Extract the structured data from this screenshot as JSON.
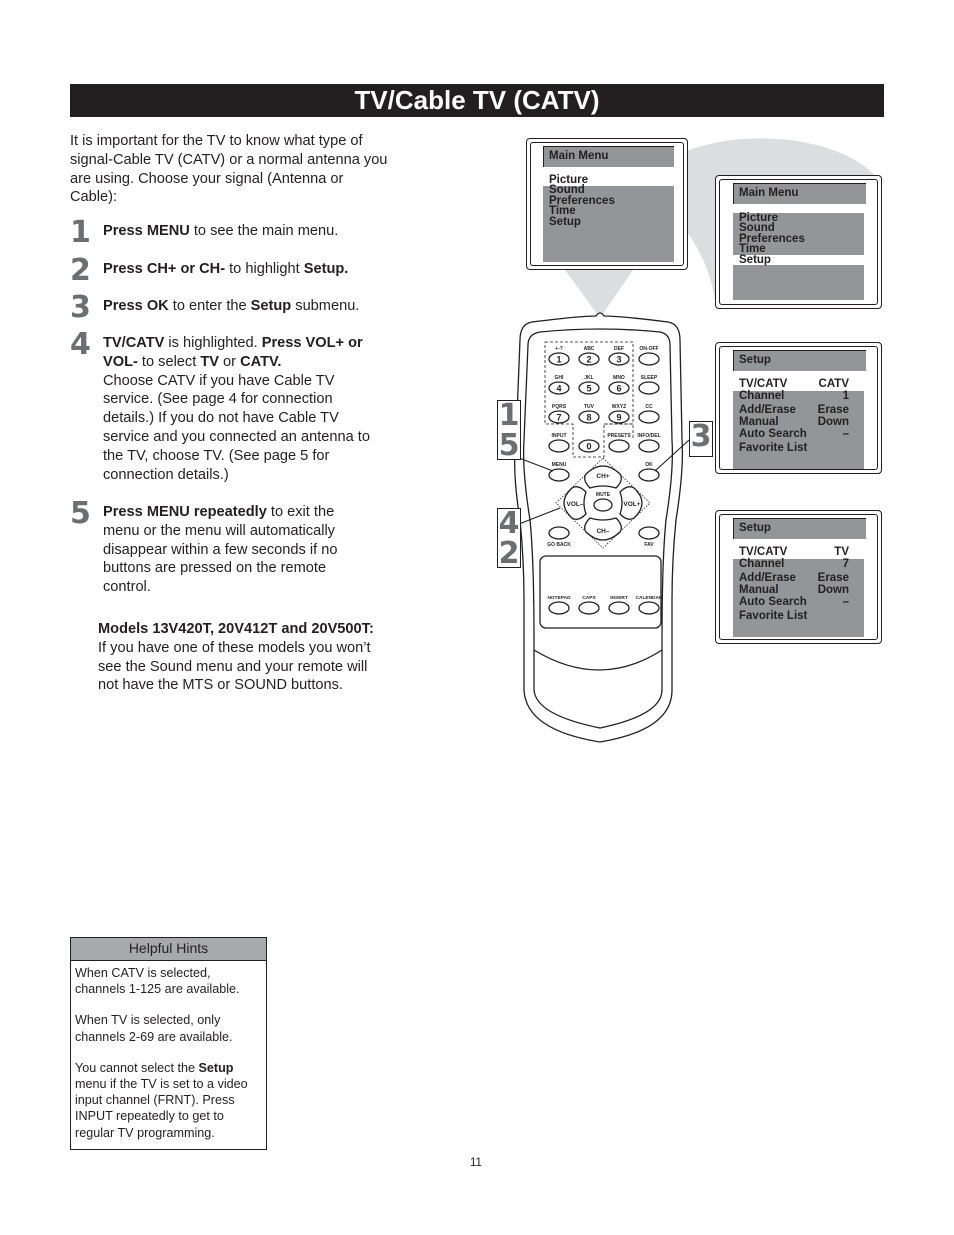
{
  "page": {
    "title": "TV/Cable TV (CATV)",
    "intro": "It is important for the TV to know what type of signal-Cable TV (CATV) or a normal antenna you are using. Choose your signal (Antenna or Cable):",
    "page_number": "11"
  },
  "steps": [
    {
      "num": "1",
      "parts": [
        {
          "b": "Press MENU"
        },
        {
          "t": " to see the main menu."
        }
      ]
    },
    {
      "num": "2",
      "parts": [
        {
          "b": "Press CH+ or CH-"
        },
        {
          "t": " to highlight "
        },
        {
          "b": "Setup."
        }
      ]
    },
    {
      "num": "3",
      "parts": [
        {
          "b": "Press OK"
        },
        {
          "t": " to enter the "
        },
        {
          "b": "Setup"
        },
        {
          "t": " submenu."
        }
      ]
    },
    {
      "num": "4",
      "parts": [
        {
          "b": "TV/CATV"
        },
        {
          "t": " is highlighted. "
        },
        {
          "b": "Press VOL+ or VOL-"
        },
        {
          "t": " to select "
        },
        {
          "b": "TV"
        },
        {
          "t": " or "
        },
        {
          "b": "CATV."
        },
        {
          "br": true
        },
        {
          "t": "Choose CATV if you have Cable TV service. (See page 4 for connection details.) If you do not have Cable TV service and you connected an antenna to the TV, choose TV. (See page 5 for connection details.)"
        }
      ]
    },
    {
      "num": "5",
      "parts": [
        {
          "b": "Press MENU repeatedly"
        },
        {
          "t": " to exit the menu or the menu will automatically disappear within a few seconds if no buttons are pressed on the remote control."
        }
      ]
    }
  ],
  "models_note": {
    "heading": "Models 13V420T, 20V412T and 20V500T:",
    "text": "If you have one of these models you won’t see the Sound menu and your remote will not have the MTS or SOUND buttons."
  },
  "helpful_hints": {
    "title": "Helpful Hints",
    "hint1": "When CATV is selected, channels 1-125 are available.",
    "hint2": "When TV is selected, only channels 2-69 are available.",
    "hint3_pre": "You cannot select the ",
    "hint3_bold": "Setup",
    "hint3_post": " menu if the TV is set to a video input channel (FRNT). Press INPUT repeatedly to get to regular TV programming."
  },
  "screens": {
    "main_menu_1": {
      "header": "Main Menu",
      "items": [
        "Picture",
        "Sound",
        "Preferences",
        "Time",
        "Setup"
      ],
      "highlighted": "Picture"
    },
    "main_menu_2": {
      "header": "Main Menu",
      "items": [
        "Picture",
        "Sound",
        "Preferences",
        "Time",
        "Setup"
      ],
      "highlighted": "Setup"
    },
    "setup_catv": {
      "header": "Setup",
      "rows": [
        {
          "label": "TV/CATV",
          "value": "CATV"
        },
        {
          "label": "Channel",
          "value": "1"
        },
        {
          "label": "Add/Erase",
          "value": "Erase"
        },
        {
          "label": "Manual",
          "value": "Down"
        },
        {
          "label": "Auto Search",
          "value": "–"
        },
        {
          "label": "Favorite List",
          "value": ""
        }
      ],
      "highlighted": "TV/CATV"
    },
    "setup_tv": {
      "header": "Setup",
      "rows": [
        {
          "label": "TV/CATV",
          "value": "TV"
        },
        {
          "label": "Channel",
          "value": "7"
        },
        {
          "label": "Add/Erase",
          "value": "Erase"
        },
        {
          "label": "Manual",
          "value": "Down"
        },
        {
          "label": "Auto Search",
          "value": "–"
        },
        {
          "label": "Favorite List",
          "value": ""
        }
      ],
      "highlighted": "TV/CATV"
    }
  },
  "remote": {
    "top_labels": [
      "+-?",
      "ABC",
      "DEF",
      "ON-OFF",
      "GHI",
      "JKL",
      "MNO",
      "SLEEP",
      "PQRS",
      "TUV",
      "WXYZ",
      "CC"
    ],
    "digits": [
      "1",
      "2",
      "3",
      "4",
      "5",
      "6",
      "7",
      "8",
      "9",
      "0"
    ],
    "input_label": "INPUT",
    "presets_label": "PRESETS",
    "info_label": "INFO/DEL",
    "menu_label": "MENU",
    "ok_label": "OK",
    "ch_up": "CH+",
    "ch_down": "CH–",
    "vol_down": "VOL–",
    "vol_up": "VOL+",
    "mute": "MUTE",
    "go_back": "GO BACK",
    "fav": "FAV",
    "bottom_labels": [
      "NOTEPAD",
      "CAPS",
      "INSERT",
      "CALENDAR"
    ]
  },
  "callouts": {
    "menu_steps": [
      "1",
      "5"
    ],
    "ok_step": "3",
    "dpad_steps": [
      "4",
      "2"
    ]
  },
  "colors": {
    "title_bar": "#231f20",
    "menu_gray": "#939598",
    "hint_header": "#a7a9ac",
    "step_number": "#6d6e71",
    "beam": "#dcddde"
  }
}
